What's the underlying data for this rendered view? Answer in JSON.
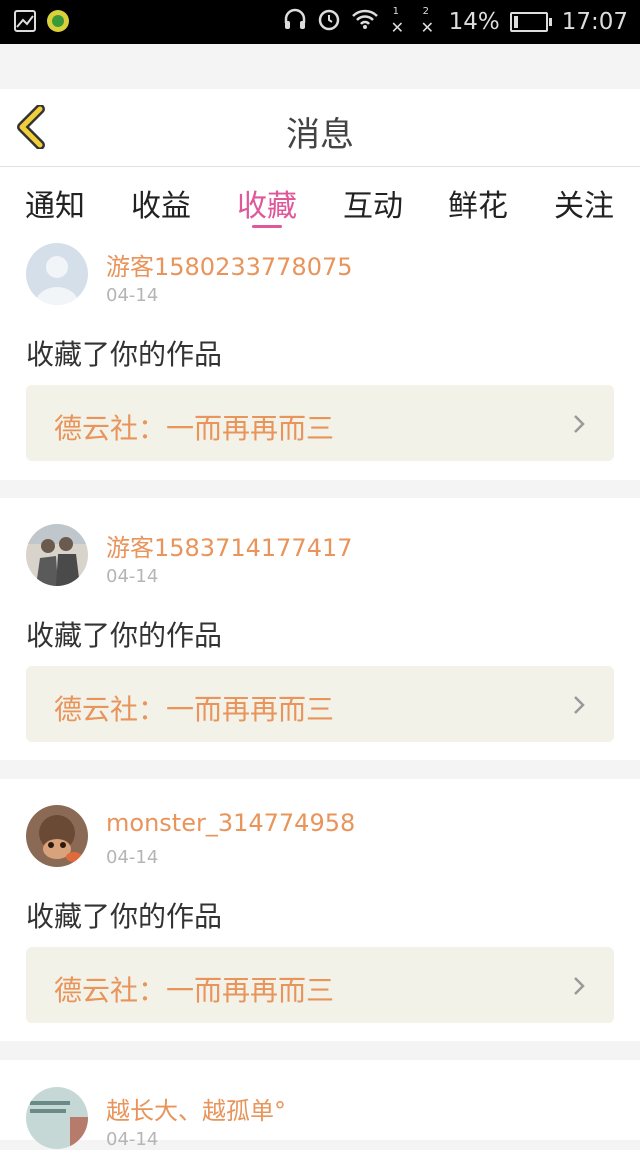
{
  "status_bar": {
    "sim1_label": "1",
    "sim2_label": "2",
    "battery": "14%",
    "time": "17:07"
  },
  "header": {
    "title": "消息"
  },
  "tabs": [
    {
      "label": "通知",
      "active": false
    },
    {
      "label": "收益",
      "active": false
    },
    {
      "label": "收藏",
      "active": true
    },
    {
      "label": "互动",
      "active": false
    },
    {
      "label": "鲜花",
      "active": false
    },
    {
      "label": "关注",
      "active": false
    }
  ],
  "messages": [
    {
      "user": "游客1580233778075",
      "date": "04-14",
      "action": "收藏了你的作品",
      "work": "德云社：一而再再而三",
      "avatar": "default-avatar"
    },
    {
      "user": "游客1583714177417",
      "date": "04-14",
      "action": "收藏了你的作品",
      "work": "德云社：一而再再而三",
      "avatar": "photo-two-people-avatar"
    },
    {
      "user": "monster_314774958",
      "date": "04-14",
      "action": "收藏了你的作品",
      "work": "德云社：一而再再而三",
      "avatar": "photo-dog-avatar"
    },
    {
      "user": "越长大、越孤单°",
      "date": "04-14",
      "avatar": "photo-text-avatar"
    }
  ],
  "colors": {
    "accent_pink": "#e0579a",
    "username_orange": "#e8945b",
    "back_arrow_yellow": "#f0cf3a",
    "work_bg": "#f3f2e8"
  }
}
